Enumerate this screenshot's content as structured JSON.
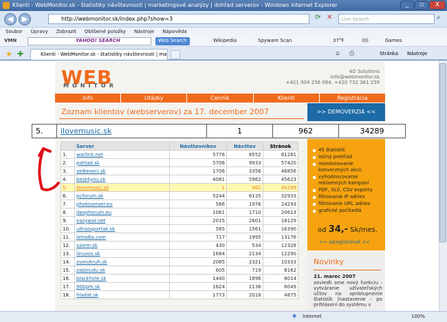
{
  "window": {
    "title": "Klienti - WebMonitor.sk - štatistiky návštevnosti | marketingové analýzy | dohľad serverov - Windows Internet Explorer",
    "min": "_",
    "max": "▫",
    "close": "X"
  },
  "address": {
    "url": "http://webmonitor.sk/index.php?show=3",
    "search_placeholder": "Live Search"
  },
  "menu": [
    "Soubor",
    "Úpravy",
    "Zobrazit",
    "Oblíbené položky",
    "Nástroje",
    "Nápověda"
  ],
  "yahoo": {
    "logo": "YAHOO! SEARCH",
    "web_search": "Web Search",
    "wikipedia": "Wikipedia",
    "spyware": "Spyware Scan",
    "temp": "37°F",
    "mail": "(0)",
    "games": "Games"
  },
  "tab": {
    "label": "Klienti - WebMonitor.sk - štatistiky návštevnosti | mar...",
    "page": "Stránka",
    "tools": "Nástroje"
  },
  "site": {
    "logo": "WEB",
    "logo_sub": "MONITOR",
    "contact": [
      "4D Solutions",
      "info@webmonitor.sk",
      "+421 904 256 084, +420 732 361 259"
    ],
    "nav": [
      "Info",
      "Otázky",
      "Cenník",
      "Klienti",
      "Registrácia"
    ],
    "heading": "Zoznam klientov (webserverov) za 17. december 2007",
    "demo": ">> DEMOVERZIA <<"
  },
  "callout": {
    "rank": "5.",
    "server": "ilovemusic.sk",
    "visitors": "1",
    "visits": "962",
    "pages": "34289"
  },
  "table": {
    "headers": [
      "Server",
      "Návštevníkov",
      "Návštev",
      "Stránok"
    ],
    "rows": [
      [
        "1.",
        "warlink.net",
        "5776",
        "8552",
        "81261"
      ],
      [
        "2.",
        "pohlad.sk",
        "5706",
        "9933",
        "57420"
      ],
      [
        "3.",
        "velkeveci.sk",
        "1706",
        "3356",
        "46856"
      ],
      [
        "4.",
        "best4you.sk",
        "4081",
        "5962",
        "45623"
      ],
      [
        "5.",
        "ilovemusic.sk",
        "1",
        "962",
        "34289"
      ],
      [
        "6.",
        "pcforum.sk",
        "5244",
        "6135",
        "32933"
      ],
      [
        "7.",
        "photoserver.eu",
        "566",
        "1976",
        "24293"
      ],
      [
        "8.",
        "davphorum.eu",
        "1061",
        "1710",
        "20613"
      ],
      [
        "9.",
        "easywar.net",
        "2015",
        "2601",
        "18129"
      ],
      [
        "10.",
        "ultrasspartak.sk",
        "585",
        "1561",
        "16390"
      ],
      [
        "11.",
        "lietadla.com",
        "717",
        "1995",
        "13176"
      ],
      [
        "12.",
        "salem.sk",
        "430",
        "534",
        "12328"
      ],
      [
        "13.",
        "linuxos.sk",
        "1684",
        "2134",
        "12290"
      ],
      [
        "14.",
        "zverokruh.sk",
        "2085",
        "2321",
        "10333"
      ],
      [
        "15.",
        "zabinudu.sk",
        "605",
        "719",
        "8162"
      ],
      [
        "16.",
        "blackhole.sk",
        "1440",
        "1896",
        "8014"
      ],
      [
        "17.",
        "90bpm.sk",
        "1624",
        "2136",
        "6049"
      ],
      [
        "18.",
        "hladat.sk",
        "1773",
        "2018",
        "4875"
      ]
    ]
  },
  "features": [
    "45 štatistík",
    "ročný prehľad",
    "monitorovanie konverzných akcií",
    "vyhodnocovanie reklamných kampaní",
    "PDF, XLS, CSV exporty",
    "filtrovanie IP adries",
    "filtrovanie URL adries",
    "grafické počítadlá"
  ],
  "price": {
    "od": "od",
    "amount": "34,-",
    "unit": "Sk/mes.",
    "register": ">> zaregistrovať <<"
  },
  "news": {
    "heading": "Novinky",
    "date": "21. marec 2007",
    "text": "zaviedli sme nový funkciu - vytváranie užívateľských účtov na spristupnenie štatistík (nastavenie - po prihlásení do systému v"
  },
  "status": {
    "zone": "Internet",
    "zoom": "100%"
  }
}
